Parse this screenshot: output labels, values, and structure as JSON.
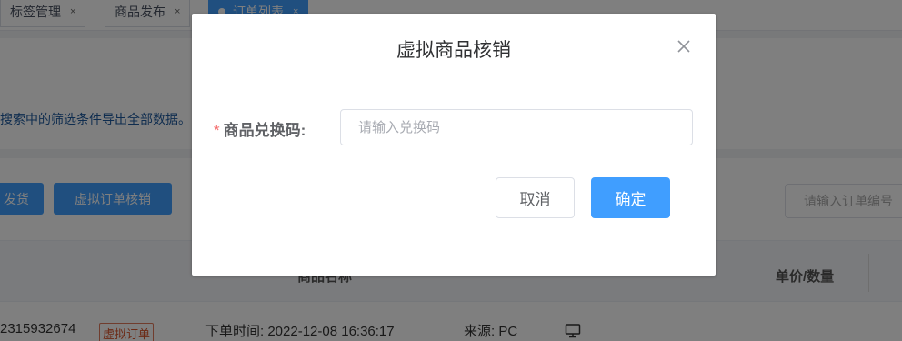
{
  "tabs": [
    {
      "label": "标签管理",
      "close": "×"
    },
    {
      "label": "商品发布",
      "close": "×"
    },
    {
      "label": "订单列表",
      "close": "×"
    }
  ],
  "hint_text": "搜索中的筛选条件导出全部数据。",
  "toolbar": {
    "ship_label": "发货",
    "verify_label": "虚拟订单核销",
    "search_placeholder": "请输入订单编号"
  },
  "table": {
    "headers": [
      "商品名称",
      "单价/数量"
    ]
  },
  "order_row": {
    "order_no": "2315932674",
    "tag": "虚拟订单",
    "order_time": "下单时间: 2022-12-08 16:36:17",
    "source": "来源: PC"
  },
  "modal": {
    "title": "虚拟商品核销",
    "required_mark": "*",
    "field_label": "商品兑换码:",
    "field_value": "",
    "field_placeholder": "请输入兑换码",
    "cancel_label": "取消",
    "confirm_label": "确定"
  },
  "colors": {
    "primary": "#409eff",
    "required": "#f56c6c",
    "tag_border": "#e07b5c"
  },
  "icons": [
    "close-icon",
    "monitor-icon",
    "dot-icon"
  ]
}
